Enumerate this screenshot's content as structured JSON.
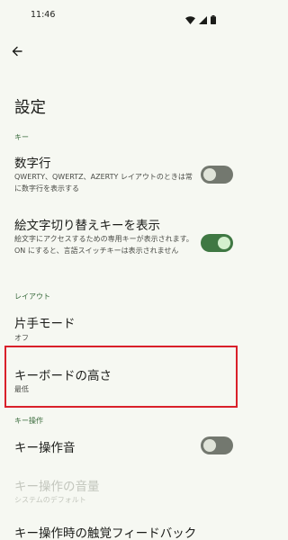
{
  "status_bar": {
    "time": "11:46"
  },
  "page": {
    "title": "設定"
  },
  "sections": {
    "keys": "キー",
    "layout": "レイアウト",
    "key_operation": "キー操作"
  },
  "prefs": {
    "number_row": {
      "title": "数字行",
      "summary": "QWERTY、QWERTZ、AZERTY レイアウトのときは常に数字行を表示する",
      "enabled": false
    },
    "emoji_switch_key": {
      "title": "絵文字切り替えキーを表示",
      "summary": "絵文字にアクセスするための専用キーが表示されます。ON にすると、言語スイッチキーは表示されません",
      "enabled": true
    },
    "one_handed_mode": {
      "title": "片手モード",
      "summary": "オフ"
    },
    "keyboard_height": {
      "title": "キーボードの高さ",
      "summary": "最低"
    },
    "key_sound": {
      "title": "キー操作音",
      "enabled": false
    },
    "key_sound_volume": {
      "title": "キー操作の音量",
      "summary": "システムのデフォルト"
    },
    "haptic_feedback": {
      "title": "キー操作時の触覚フィードバック"
    }
  },
  "colors": {
    "background": "#f6f8f2",
    "accent": "#386a3b",
    "toggle_on": "#3f7843",
    "toggle_off": "#73786f",
    "highlight": "#d9202a"
  },
  "icons": {
    "back": "arrow-back-icon",
    "wifi": "wifi-icon",
    "signal": "signal-icon",
    "battery": "battery-icon"
  }
}
